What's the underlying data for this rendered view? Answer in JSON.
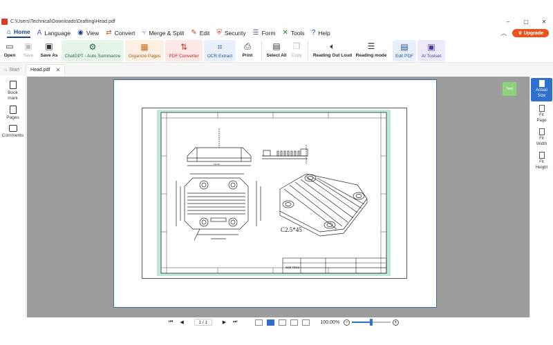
{
  "window": {
    "path": "C:\\Users\\Technical\\Downloads\\Drafting\\Head.pdf",
    "controls": [
      "–",
      "▢",
      "✕"
    ]
  },
  "menu": {
    "items": [
      {
        "label": "Home",
        "icon": "home-icon"
      },
      {
        "label": "Language",
        "icon": "language-icon"
      },
      {
        "label": "View",
        "icon": "eye-icon"
      },
      {
        "label": "Convert",
        "icon": "convert-icon"
      },
      {
        "label": "Merge & Split",
        "icon": "merge-icon"
      },
      {
        "label": "Edit",
        "icon": "pen-icon"
      },
      {
        "label": "Security",
        "icon": "shield-icon"
      },
      {
        "label": "Form",
        "icon": "form-icon"
      },
      {
        "label": "Tools",
        "icon": "tools-icon"
      },
      {
        "label": "Help",
        "icon": "help-icon"
      }
    ],
    "active": "Home",
    "upgrade_label": "Upgrade"
  },
  "ribbon": {
    "open": "Open",
    "save": "Save",
    "save_as": "Save As",
    "chatgpt": "ChatGPT - Auto Summarize",
    "organize": "Organize Pages",
    "pdf_converter": "PDF Converter",
    "ocr": "OCR Extract",
    "print": "Print",
    "select_all": "Select All",
    "copy": "Copy",
    "read_aloud": "Reading Out Loud",
    "reading_mode": "Reading mode",
    "edit_pdf": "Edit PDF",
    "ai_toolset": "AI Toolset"
  },
  "tabs": {
    "start": "Start",
    "file": "Head.pdf"
  },
  "left_sidebar": {
    "bookmark": "Book mark",
    "pages": "Pages",
    "comments": "Comments"
  },
  "text_button": "Text",
  "drawing": {
    "chamfer_note": "C2.5*45",
    "company": "SOE TECH"
  },
  "right_sidebar": {
    "actual_size": "Actual Size",
    "fit_page": "Fit Page",
    "fit_width": "Fit Width",
    "fit_height": "Fit Height"
  },
  "bottom": {
    "page_indicator": "1 / 1",
    "zoom": "100.00%",
    "zoom_level": 0.5
  },
  "colors": {
    "accent": "#1a3e8c",
    "upgrade": "#e8541e",
    "active_blue": "#2f6fcd",
    "doc_bg": "#9c9c9c",
    "frame_green": "#bfead8"
  }
}
